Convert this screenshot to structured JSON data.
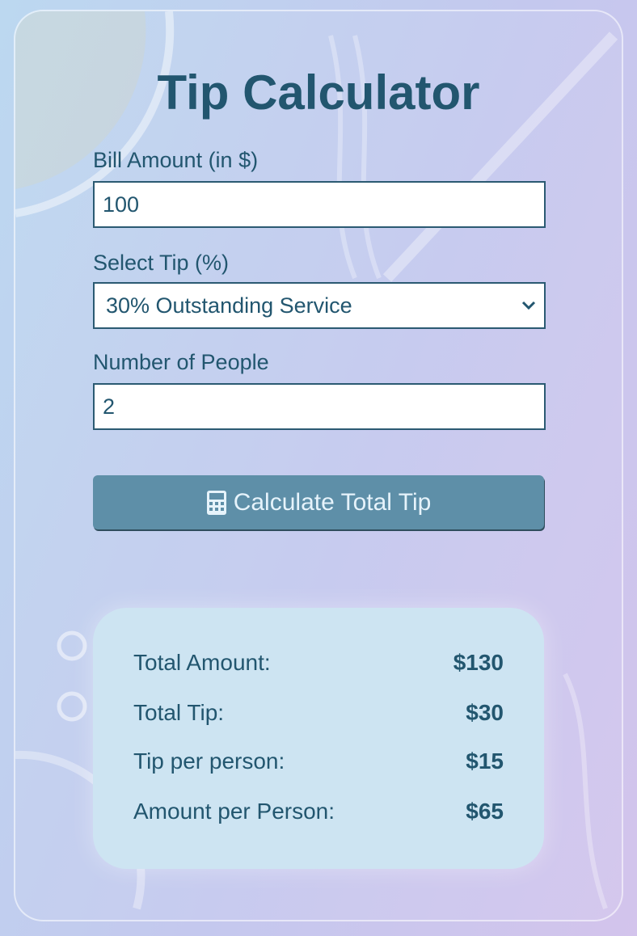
{
  "title": "Tip Calculator",
  "bill": {
    "label": "Bill Amount (in $)",
    "value": "100"
  },
  "tip": {
    "label": "Select Tip (%)",
    "selected": "30% Outstanding Service"
  },
  "people": {
    "label": "Number of People",
    "value": "2"
  },
  "button": {
    "icon": "calculator-icon",
    "label": "Calculate Total Tip"
  },
  "results": [
    {
      "label": "Total Amount:",
      "value": "$130"
    },
    {
      "label": "Total Tip:",
      "value": "$30"
    },
    {
      "label": "Tip per person:",
      "value": "$15"
    },
    {
      "label": "Amount per Person:",
      "value": "$65"
    }
  ],
  "colors": {
    "text": "#22566f",
    "button": "#5e8fa8",
    "results_bg": "#cde4f2"
  }
}
